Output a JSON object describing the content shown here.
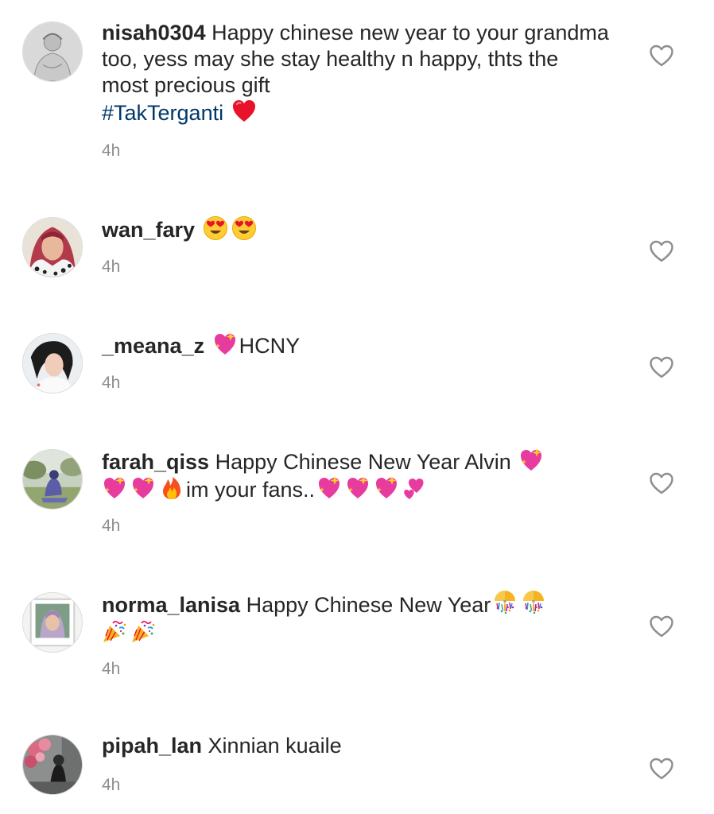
{
  "comments": [
    {
      "username": "nisah0304",
      "text": "Happy chinese new year to your grandma too, yess may she stay healthy n happy, thts the most precious gift",
      "hashtag": "#TakTerganti",
      "emoji": [
        "red-heart"
      ],
      "time": "4h",
      "avatar": "sketch-portrait"
    },
    {
      "username": "wan_fary",
      "text": "",
      "emoji": [
        "heart-eyes",
        "heart-eyes"
      ],
      "time": "4h",
      "avatar": "hijab-selfie"
    },
    {
      "username": "_meana_z",
      "text": "HCNY",
      "emoji": [
        "sparkling-heart"
      ],
      "time": "4h",
      "avatar": "girl-selfie"
    },
    {
      "username": "farah_qiss",
      "text_a": "Happy Chinese New Year Alvin",
      "text_b": "im your fans..",
      "emoji": [
        "sparkling-heart",
        "sparkling-heart",
        "sparkling-heart",
        "fire",
        "sparkling-heart",
        "sparkling-heart",
        "sparkling-heart",
        "two-hearts"
      ],
      "time": "4h",
      "avatar": "park-photo"
    },
    {
      "username": "norma_lanisa",
      "text": "Happy Chinese New Year",
      "emoji": [
        "confetti-ball",
        "confetti-ball",
        "party-popper",
        "party-popper"
      ],
      "time": "4h",
      "avatar": "framed-portrait"
    },
    {
      "username": "pipah_lan",
      "text": "Xinnian kuaile",
      "emoji": [],
      "time": "4h",
      "avatar": "blossom-photo"
    }
  ],
  "colors": {
    "username": "#262626",
    "text": "#262626",
    "hashtag": "#00376b",
    "timestamp": "#8e8e8e",
    "like_icon": "#8e8e8e"
  },
  "icons": {
    "like": "heart-outline-icon"
  }
}
